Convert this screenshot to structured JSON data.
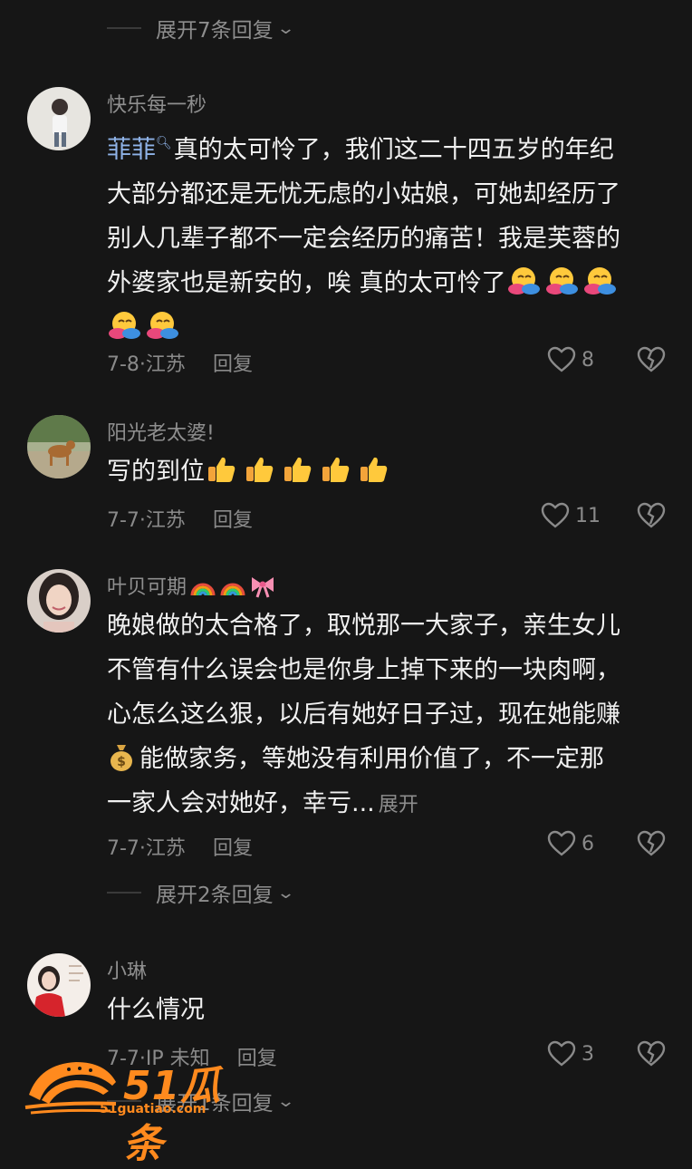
{
  "top_expand": {
    "label": "展开7条回复"
  },
  "comments": [
    {
      "username": "快乐每一秒",
      "mention": "菲菲",
      "text_lines": [
        "真的太可怜了，我们这二十四五岁的年纪",
        "大部分都还是无忧无虑的小姑娘，可她却经历了",
        "别人几辈子都不一定会经历的痛苦！我是芙蓉的",
        "外婆家也是新安的，唉 真的太可怜了"
      ],
      "date_loc": "7-8·江苏",
      "reply": "回复",
      "likes": "8",
      "emoji": "hugging-face"
    },
    {
      "username": "阳光老太婆!",
      "text": "写的到位",
      "date_loc": "7-7·江苏",
      "reply": "回复",
      "likes": "11",
      "emoji": "thumbs-up"
    },
    {
      "username": "叶贝可期",
      "username_emoji": [
        "rainbow",
        "rainbow",
        "ribbon"
      ],
      "text_lines": [
        "晚娘做的太合格了，取悦那一大家子，亲生女儿",
        "不管有什么误会也是你身上掉下来的一块肉啊，",
        "心怎么这么狠，以后有她好日子过，现在她能赚",
        "能做家务，等她没有利用价值了，不一定那",
        "一家人会对她好，幸亏..."
      ],
      "more": "展开",
      "date_loc": "7-7·江苏",
      "reply": "回复",
      "likes": "6",
      "emoji": "money-bag"
    },
    {
      "username": "小琳",
      "text": "什么情况",
      "date_loc": "7-7·IP 未知",
      "reply": "回复",
      "likes": "3"
    }
  ],
  "mid_expand": {
    "label": "展开2条回复"
  },
  "bottom_expand": {
    "label": "展开1条回复"
  },
  "watermark": {
    "brand": "51瓜条",
    "url": "51guatiao.com"
  },
  "colors": {
    "background": "#161616",
    "text": "#f1f1f1",
    "muted": "#8a8a8a",
    "mention": "#8fb3e8",
    "watermark": "#ff8a1e"
  }
}
